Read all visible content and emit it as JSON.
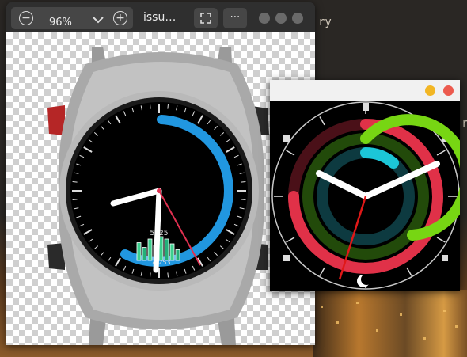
{
  "viewer": {
    "zoom_out_icon": "minus-circle-icon",
    "zoom_value": "96%",
    "zoom_in_icon": "plus-circle-icon",
    "title": "issu…",
    "fullscreen_icon": "fullscreen-icon",
    "menu_icon": "more-icon"
  },
  "watch1": {
    "step_count": "5725",
    "secondary_value": "4/253",
    "bar_levels": [
      0.75,
      0.55,
      0.9,
      0.65,
      1.0,
      0.9,
      0.7,
      0.45
    ]
  },
  "watch2": {
    "min_btn_color": "#f2b624",
    "close_btn_color": "#ec5a4e",
    "ring_colors": [
      "#e03148",
      "#77d613",
      "#1cc6d8"
    ]
  },
  "desktop": {
    "text_fragments": [
      "ry",
      "r"
    ]
  }
}
